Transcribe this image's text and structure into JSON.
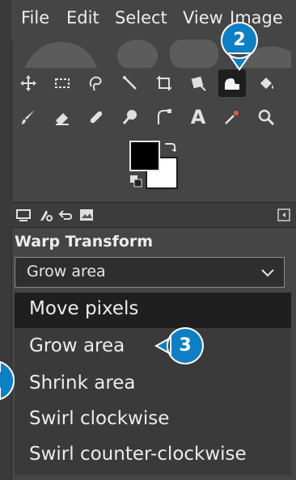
{
  "menubar": {
    "items": [
      "File",
      "Edit",
      "Select",
      "View",
      "Image"
    ]
  },
  "toolbox": {
    "tools_row1": [
      "move-tool-icon",
      "rect-select-tool-icon",
      "free-select-tool-icon",
      "fuzzy-select-tool-icon",
      "crop-tool-icon",
      "unified-transform-tool-icon",
      "warp-transform-tool-icon",
      "bucket-fill-tool-icon"
    ],
    "tools_row2": [
      "paintbrush-tool-icon",
      "eraser-tool-icon",
      "heal-tool-icon",
      "smudge-tool-icon",
      "paths-tool-icon",
      "text-tool-icon",
      "color-picker-tool-icon",
      "zoom-tool-icon"
    ],
    "active_tool": "warp-transform-tool-icon",
    "text_tool_glyph": "A",
    "foreground_color": "#000000",
    "background_color": "#ffffff"
  },
  "dock": {
    "tabs": [
      "tool-options-tab-icon",
      "device-status-tab-icon",
      "undo-history-tab-icon",
      "images-tab-icon"
    ],
    "panel_title": "Warp Transform",
    "behavior_select": {
      "value": "Grow area",
      "options": [
        "Move pixels",
        "Grow area",
        "Shrink area",
        "Swirl clockwise",
        "Swirl counter-clockwise"
      ],
      "highlighted": "Move pixels"
    }
  },
  "callouts": [
    {
      "number": "2",
      "color": "#0f7fc3"
    },
    {
      "number": "3",
      "color": "#0f7fc3"
    }
  ]
}
